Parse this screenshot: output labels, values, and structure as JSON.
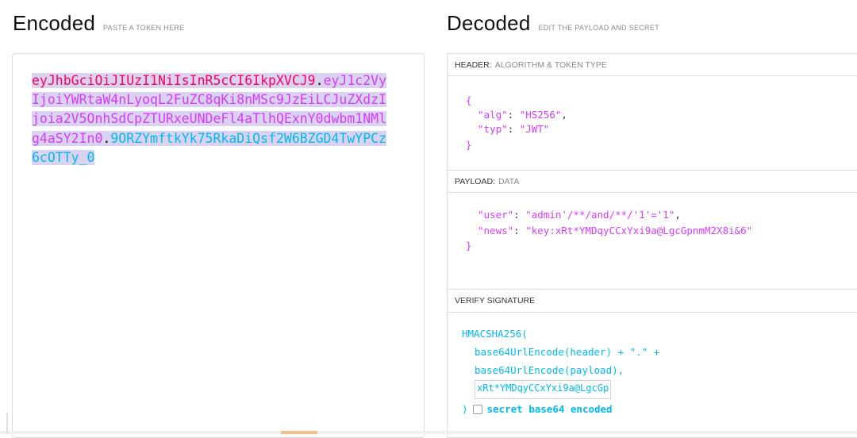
{
  "encoded": {
    "title": "Encoded",
    "hint": "PASTE A TOKEN HERE",
    "token_header": "eyJhbGciOiJIUzI1NiIsInR5cCI6IkpXVCJ9",
    "dot1": ".",
    "token_payload": "eyJ1c2VyIjoiYWRtaW4nLyoqL2FuZC8qKi8nMSc9JzEiLCJuZXdzIjoia2V5OnhSdCpZTURxeUNDeFl4aTlhQExnY0dwbm1NMlg4aSY2In0",
    "dot2": ".",
    "token_signature": "9ORZYmftkYk75RkaDiQsf2W6BZGD4TwYPCz6cOTTy_0",
    "colors": {
      "header": "#fb015b",
      "payload": "#d63aff",
      "signature": "#00b9f1",
      "highlight": "#d9d3f1"
    }
  },
  "decoded": {
    "title": "Decoded",
    "hint": "EDIT THE PAYLOAD AND SECRET",
    "header_section": {
      "label": "HEADER:",
      "sublabel": "ALGORITHM & TOKEN TYPE",
      "open_brace": "{",
      "alg_key": "\"alg\"",
      "alg_value": "\"HS256\"",
      "typ_key": "\"typ\"",
      "typ_value": "\"JWT\"",
      "close_brace": "}"
    },
    "payload_section": {
      "label": "PAYLOAD:",
      "sublabel": "DATA",
      "user_key": "\"user\"",
      "user_value": "\"admin'/**/and/**/'1'='1\"",
      "news_key": "\"news\"",
      "news_value": "\"key:xRt*YMDqyCCxYxi9a@LgcGpnmM2X8i&6\"",
      "close_brace": "}"
    },
    "signature_section": {
      "label": "VERIFY SIGNATURE",
      "line1": "HMACSHA256(",
      "line2": "base64UrlEncode(header) + \".\" +",
      "line3": "base64UrlEncode(payload),",
      "secret_value": "xRt*YMDqyCCxYxi9a@LgcGp",
      "close": ")",
      "checkbox_label": "secret base64 encoded",
      "checkbox_checked": false
    }
  }
}
